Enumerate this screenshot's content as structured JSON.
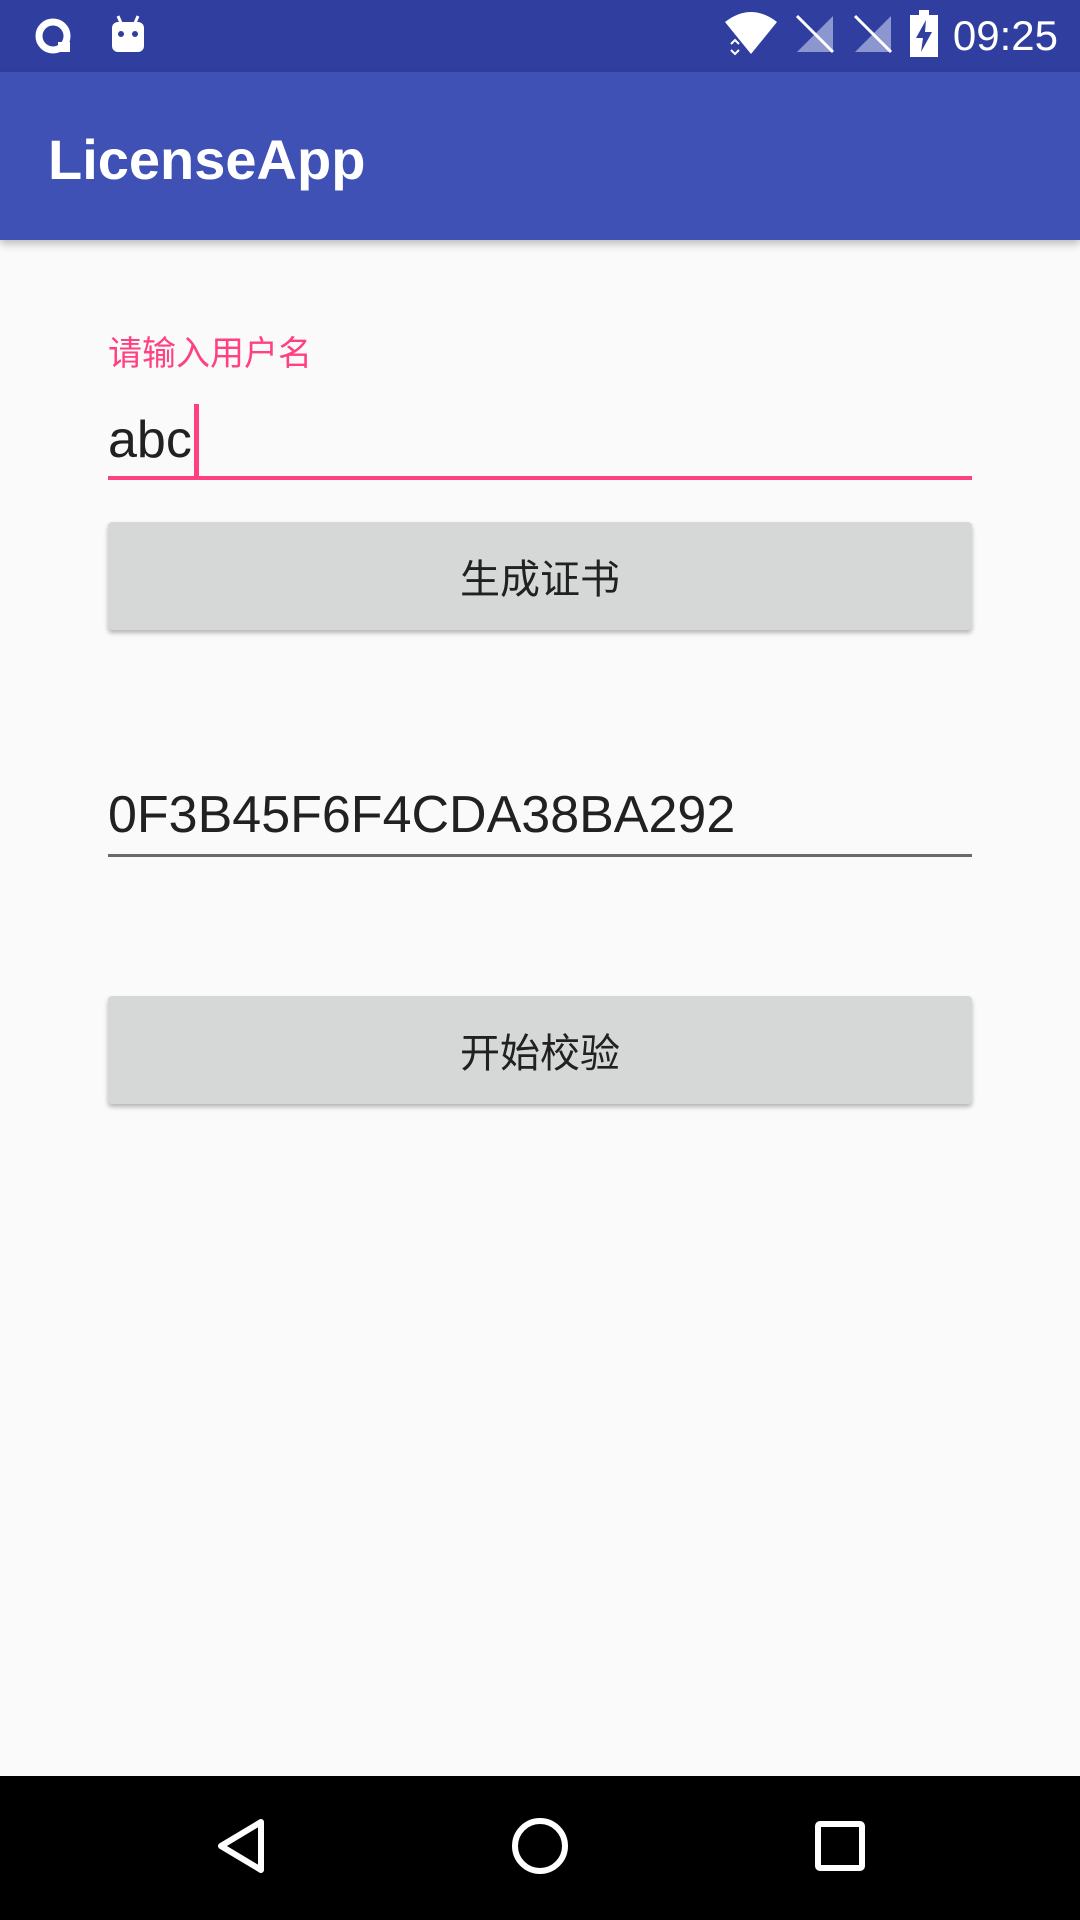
{
  "status_bar": {
    "time": "09:25",
    "left_icons": [
      "notification-q-icon",
      "android-debug-icon"
    ],
    "right_icons": [
      "wifi-icon",
      "sim-no-signal-icon",
      "sim-no-signal-icon",
      "battery-charging-icon"
    ]
  },
  "app_bar": {
    "title": "LicenseApp"
  },
  "form": {
    "username_label": "请输入用户名",
    "username_value": "abc",
    "generate_button_label": "生成证书",
    "license_value": "0F3B45F6F4CDA38BA292",
    "verify_button_label": "开始校验"
  },
  "nav_bar": {
    "back_icon": "back-icon",
    "home_icon": "home-icon",
    "recents_icon": "recents-icon"
  },
  "colors": {
    "status_bar": "#303f9f",
    "app_bar": "#3f51b5",
    "accent": "#ff4081",
    "button_bg": "#d6d7d7",
    "background": "#fafafa"
  }
}
